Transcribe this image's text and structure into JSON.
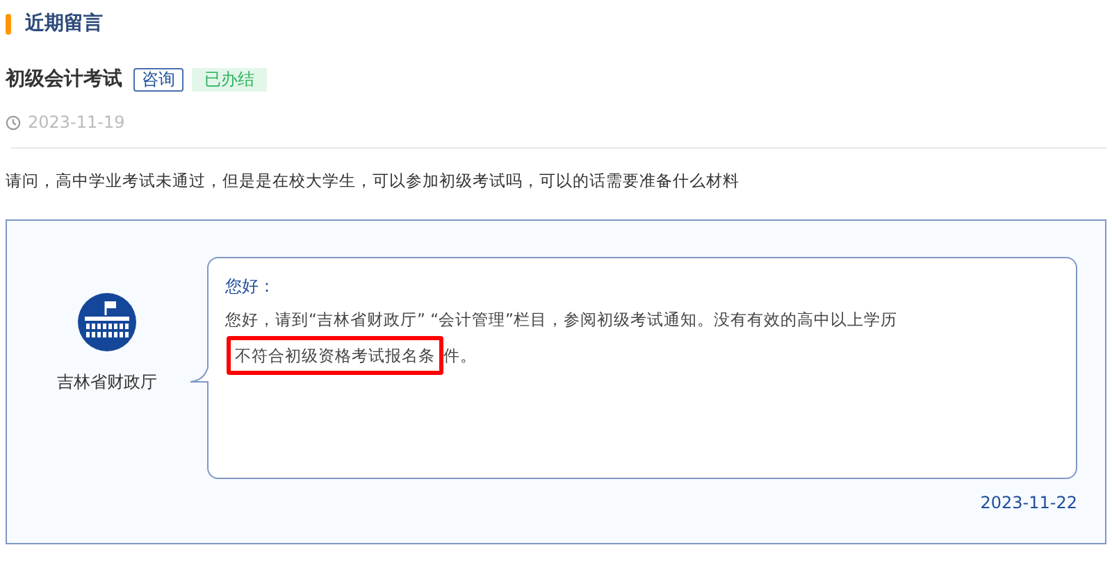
{
  "section_title": "近期留言",
  "message": {
    "title": "初级会计考试",
    "type_tag": "咨询",
    "status_tag": "已办结",
    "date": "2023-11-19",
    "question": "请问，高中学业考试未通过，但是是在校大学生，可以参加初级考试吗，可以的话需要准备什么材料"
  },
  "reply": {
    "responder": "吉林省财政厅",
    "greeting": "您好：",
    "segments": [
      {
        "kind": "plain",
        "text": "您好，请到“吉林省财政厅” “会计管理”栏目，参阅初级考试通知。没有有效的高中以上学历"
      },
      {
        "kind": "highlight",
        "text": "不符合初级资格考试报名条"
      },
      {
        "kind": "plain",
        "text": "件。"
      }
    ],
    "date": "2023-11-22"
  }
}
